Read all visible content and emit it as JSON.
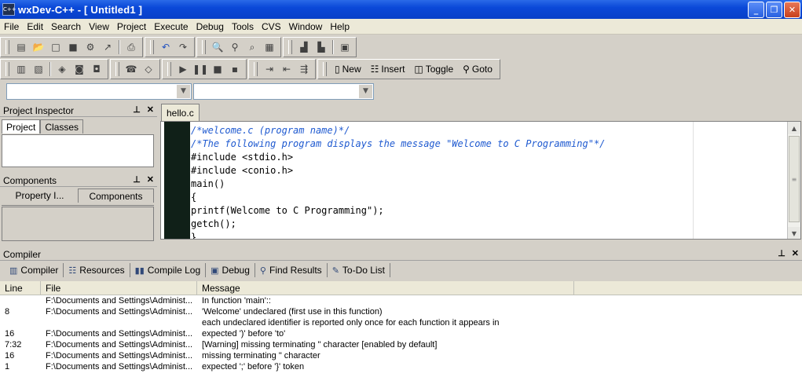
{
  "window": {
    "title": "wxDev-C++   - [ Untitled1 ]",
    "icon_label": "C++"
  },
  "menu": [
    "File",
    "Edit",
    "Search",
    "View",
    "Project",
    "Execute",
    "Debug",
    "Tools",
    "CVS",
    "Window",
    "Help"
  ],
  "toolbar2": {
    "new": "New",
    "insert": "Insert",
    "toggle": "Toggle",
    "goto": "Goto"
  },
  "left": {
    "project_inspector": "Project Inspector",
    "tab_project": "Project",
    "tab_classes": "Classes",
    "components": "Components",
    "tab_property": "Property I...",
    "tab_components": "Components"
  },
  "editor": {
    "tab": "hello.c",
    "lines": [
      "/*welcome.c (program name)*/",
      "/*The following program displays the message \"Welcome to C Programming\"*/",
      "#include <stdio.h>",
      "#include <conio.h>",
      "main()",
      "{",
      "printf(Welcome to C Programming\");",
      "getch();",
      "}"
    ]
  },
  "compiler": {
    "title": "Compiler",
    "tabs": [
      "Compiler",
      "Resources",
      "Compile Log",
      "Debug",
      "Find Results",
      "To-Do List"
    ],
    "headers": [
      "Line",
      "File",
      "Message"
    ],
    "rows": [
      [
        "",
        "F:\\Documents and Settings\\Administ...",
        "In function 'main'::"
      ],
      [
        "8",
        "F:\\Documents and Settings\\Administ...",
        "'Welcome' undeclared (first use in this function)"
      ],
      [
        "",
        "",
        "each undeclared identifier is reported only once for each function it appears in"
      ],
      [
        "16",
        "F:\\Documents and Settings\\Administ...",
        "expected ')' before 'to'"
      ],
      [
        "7:32",
        "F:\\Documents and Settings\\Administ...",
        "[Warning] missing terminating \" character [enabled by default]"
      ],
      [
        "16",
        "F:\\Documents and Settings\\Administ...",
        "missing terminating \" character"
      ],
      [
        "1",
        "F:\\Documents and Settings\\Administ...",
        "expected ';' before '}' token"
      ]
    ]
  }
}
